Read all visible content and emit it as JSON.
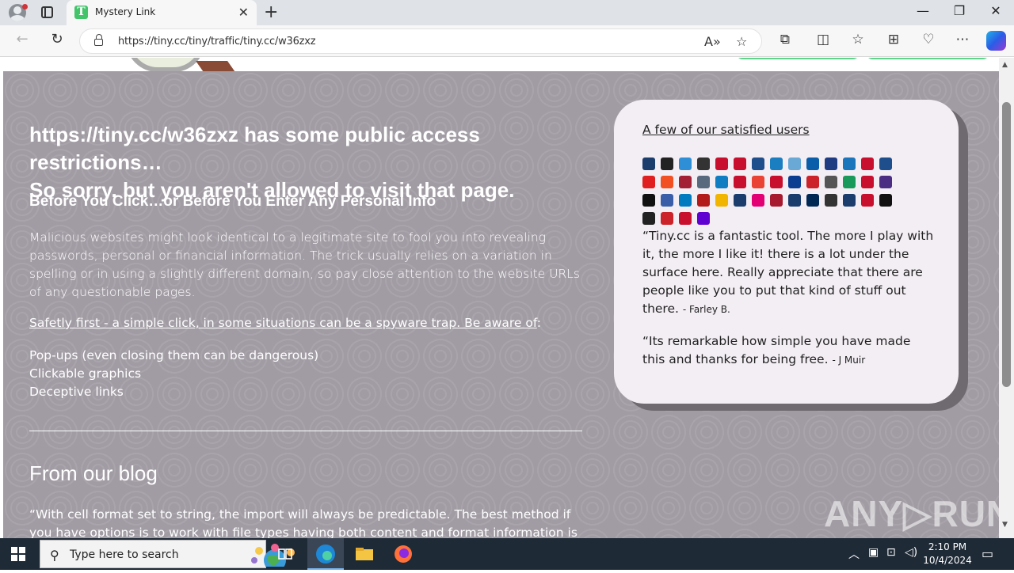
{
  "browser": {
    "tab_title": "Mystery Link",
    "favicon_letter": "T",
    "url": "https://tiny.cc/tiny/traffic/tiny.cc/w36zxz",
    "icons": [
      "profile-icon",
      "tab-actions-icon",
      "close-icon",
      "new-tab-icon",
      "minimize-icon",
      "restore-icon",
      "window-close-icon",
      "back-icon",
      "refresh-icon",
      "lock-icon",
      "read-aloud-icon",
      "favorite-star-icon",
      "extensions-icon",
      "split-screen-icon",
      "favorites-icon",
      "collections-icon",
      "browser-essentials-icon",
      "more-icon",
      "copilot-icon"
    ]
  },
  "page": {
    "heading_line1": "https://tiny.cc/w36zxz has some public access restrictions…",
    "heading_line2": "So sorry, but you aren't allowed to visit that page.",
    "subheading": "Before You Click…or Before You Enter Any Personal Info",
    "paragraph": "Malicious websites might look identical to a legitimate site to fool you into revealing passwords, personal or financial information. The trick usually relies on a variation in spelling or in using a slightly different domain, so pay close attention to the website URLs of any questionable pages.",
    "safety_link": "Safetly first - a simple click, in some situations can be a spyware trap. Be aware of",
    "safety_colon": ":",
    "bullets": [
      "Pop-ups (even closing them can be dangerous)",
      "Clickable graphics",
      "Deceptive links"
    ],
    "blog_heading": "From our blog",
    "blog_text": "“With cell format set to string, the import will always be predictable. The best method if you have options is to work with file types having both content and format information is"
  },
  "card": {
    "title": "A few of our satisfied users",
    "logo_colors": [
      "#1b3d6e",
      "#222",
      "#2f8fd6",
      "#333",
      "#c8102e",
      "#c8102e",
      "#1f4e8c",
      "#1a7ec1",
      "#6aa9d6",
      "#0a5da8",
      "#1f3b82",
      "#1b75bb",
      "#c8102e",
      "#1f4e8c",
      "#e02020",
      "#f25022",
      "#a31f34",
      "#5a6a7e",
      "#0f7dc2",
      "#c8102e",
      "#ea4335",
      "#c8102e",
      "#0b3d91",
      "#cc2229",
      "#555",
      "#1a9a5a",
      "#c8102e",
      "#4b2e83",
      "#111",
      "#3a5fa8",
      "#007bc0",
      "#b31b1b",
      "#f1b500",
      "#1b3d6e",
      "#e20074",
      "#a6192e",
      "#1b3d6e",
      "#002855",
      "#333",
      "#1b3d6e",
      "#c8102e",
      "#111",
      "#222",
      "#cc2229",
      "#c8102e",
      "#6001d2"
    ],
    "quote1": "“Tiny.cc is a fantastic tool. The more I play with it, the more I like it! there is a lot under the surface here. Really appreciate that there are people like you to put that kind of stuff out there.",
    "quote1_author": "- Farley B.",
    "quote2": "“Its remarkable how simple you have made this and thanks for being free.",
    "quote2_author": "- J Muir"
  },
  "watermark": "ANY▷RUN",
  "taskbar": {
    "search_placeholder": "Type here to search",
    "time": "2:10 PM",
    "date": "10/4/2024"
  }
}
